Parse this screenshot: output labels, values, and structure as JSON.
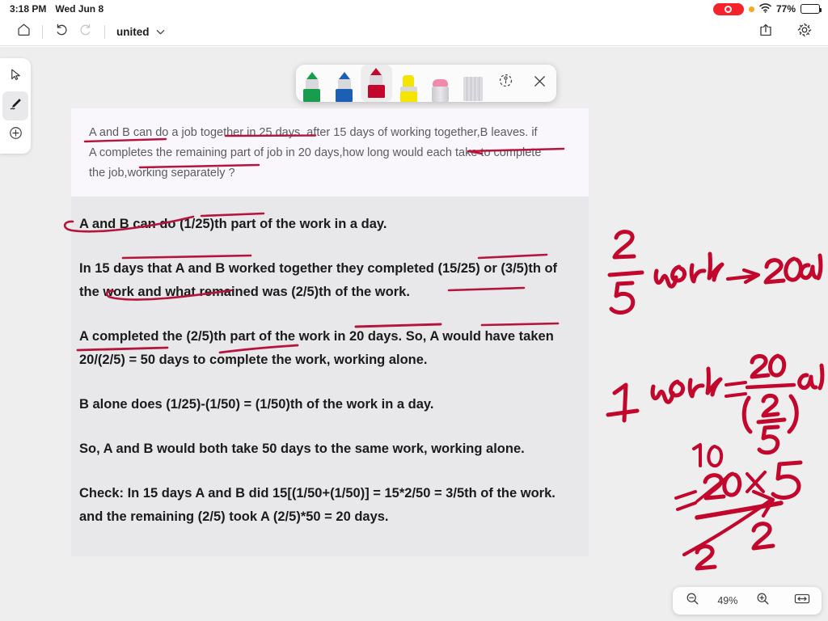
{
  "statusbar": {
    "time": "3:18 PM",
    "date": "Wed Jun 8",
    "recording_icon": "record-indicator",
    "privacy_dot_icon": "orange-privacy-dot",
    "wifi_icon": "wifi-icon",
    "battery_percent": "77%",
    "battery_level": 77
  },
  "navbar": {
    "home_icon": "home-icon",
    "undo_icon": "undo-icon",
    "redo_icon": "redo-icon",
    "document_title": "united",
    "title_chevron_icon": "chevron-down-icon",
    "share_icon": "share-icon",
    "settings_icon": "gear-icon"
  },
  "toolrail": {
    "items": [
      {
        "name": "select-tool",
        "icon": "cursor-arrow-icon",
        "selected": false
      },
      {
        "name": "pen-tool",
        "icon": "pen-icon",
        "selected": true
      },
      {
        "name": "add-tool",
        "icon": "plus-circle-icon",
        "selected": false
      }
    ]
  },
  "penbar": {
    "tools": [
      {
        "name": "green-pen",
        "label": "Green pen",
        "color": "#1a9c4e",
        "selected": false
      },
      {
        "name": "blue-pen",
        "label": "Blue pen",
        "color": "#1d5fb4",
        "selected": false
      },
      {
        "name": "red-pen",
        "label": "Red pen",
        "color": "#c2062c",
        "selected": true
      },
      {
        "name": "yellow-highlighter",
        "label": "Yellow highlighter",
        "color": "#f5e400",
        "selected": false
      },
      {
        "name": "pink-eraser",
        "label": "Eraser",
        "color": "#f08aa8",
        "selected": false
      },
      {
        "name": "ruler",
        "label": "Ruler",
        "color": "#c9c9cd",
        "selected": false
      }
    ],
    "lasso_icon": "lasso-select-icon",
    "close_icon": "close-icon"
  },
  "question": {
    "lines": [
      "A and B can do a job together in 25 days. after 15 days of working together,B leaves. if",
      "A completes the remaining part of job in 20 days,how long would each take to complete",
      "the job,working separately ?"
    ]
  },
  "answer": {
    "paragraphs": [
      "A and B can do (1/25)th part of the work in a day.",
      "In 15 days that A and B worked together they completed (15/25) or (3/5)th of the work and what remained was (2/5)th of the work.",
      "A completed the (2/5)th part of the work in 20 days. So, A would have taken 20/(2/5) = 50 days to complete the work, working alone.",
      "B alone does (1/25)-(1/50) = (1/50)th of the work in a day.",
      "So, A and B would both take 50 days to the same work, working alone.",
      "Check: In 15 days A and B did 15[(1/50+(1/50)] = 15*2/50 = 3/5th of the work. and the remaining (2/5) took A (2/5)*50 = 20 days."
    ]
  },
  "handwriting": {
    "ink_color": "#c2062c",
    "notes": [
      {
        "name": "fraction-two-fifths",
        "text": "2/5"
      },
      {
        "name": "work-arrow-days",
        "text": "work -> 20 days"
      },
      {
        "name": "one-work-equation",
        "text": "1 work = 20/(2/5) days"
      },
      {
        "name": "cancellation-ten",
        "text": "10"
      },
      {
        "name": "computation",
        "text": "= 20x5 / 2"
      },
      {
        "name": "denominator-two",
        "text": "2"
      }
    ]
  },
  "zoomcontrol": {
    "zoom_out_icon": "zoom-out-icon",
    "zoom_level": "49%",
    "zoom_in_icon": "zoom-in-icon",
    "fit_width_icon": "fit-width-icon"
  }
}
